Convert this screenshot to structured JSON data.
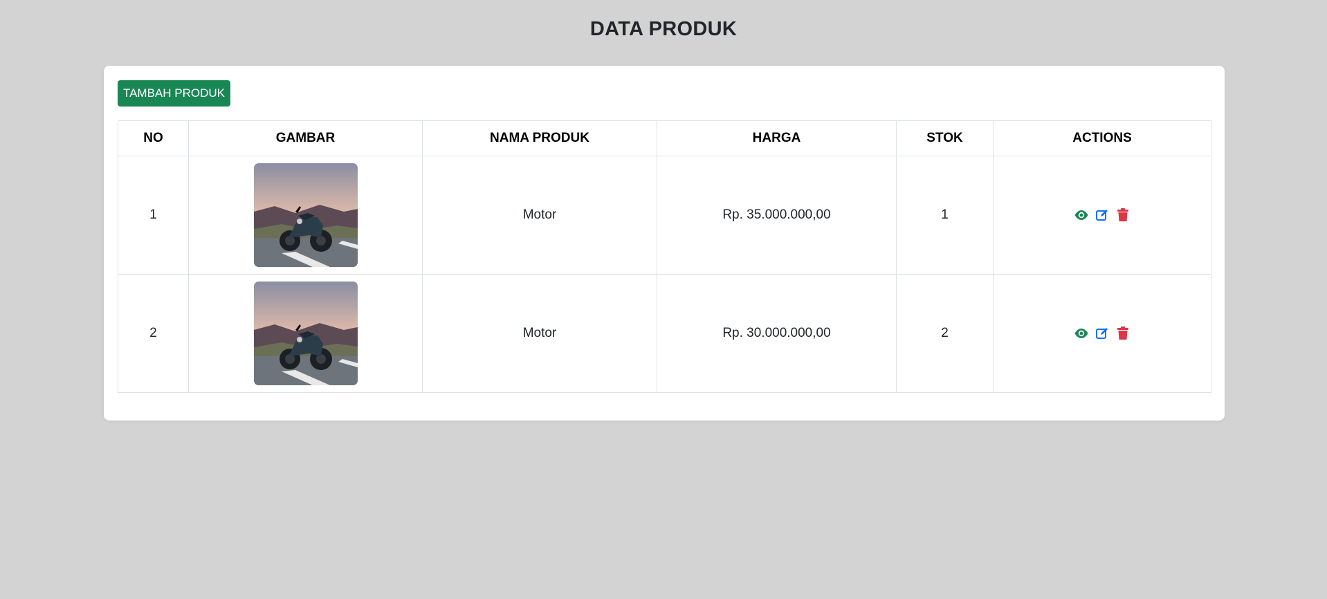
{
  "page": {
    "title": "DATA PRODUK"
  },
  "toolbar": {
    "add_label": "TAMBAH PRODUK"
  },
  "table": {
    "headers": [
      "NO",
      "GAMBAR",
      "NAMA PRODUK",
      "HARGA",
      "STOK",
      "ACTIONS"
    ],
    "rows": [
      {
        "no": "1",
        "image": "motorcycle-photo",
        "name": "Motor",
        "price": "Rp. 35.000.000,00",
        "stock": "1"
      },
      {
        "no": "2",
        "image": "motorcycle-photo",
        "name": "Motor",
        "price": "Rp. 30.000.000,00",
        "stock": "2"
      }
    ]
  },
  "icons": {
    "view": "eye-icon",
    "edit": "edit-icon",
    "delete": "trash-icon"
  },
  "colors": {
    "background": "#d3d3d3",
    "primary_button": "#198754",
    "view": "#198754",
    "edit": "#0d6efd",
    "delete": "#dc3545"
  }
}
